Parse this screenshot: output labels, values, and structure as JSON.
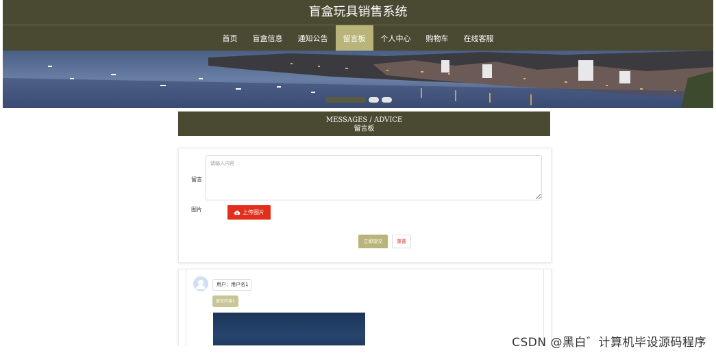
{
  "site": {
    "title": "盲盒玩具销售系统"
  },
  "nav": {
    "items": [
      {
        "label": "首页"
      },
      {
        "label": "盲盒信息"
      },
      {
        "label": "通知公告"
      },
      {
        "label": "留言板",
        "active": true
      },
      {
        "label": "个人中心"
      },
      {
        "label": "购物车"
      },
      {
        "label": "在线客服"
      }
    ]
  },
  "banner": {
    "slides": 3,
    "active_slide": 1
  },
  "section": {
    "title_en": "MESSAGES / ADVICE",
    "title_zh": "留言板"
  },
  "form": {
    "message_label": "留言",
    "message_placeholder": "请输入内容",
    "image_label": "图片",
    "upload_label": "上传图片",
    "submit_label": "立即提交",
    "reset_label": "重置"
  },
  "messages": [
    {
      "user": "用户：用户名1",
      "content": "留言内容1"
    }
  ],
  "watermark": "CSDN @黑白゛计算机毕设源码程序",
  "colors": {
    "primary": "#4a4a33",
    "accent": "#b9b57a",
    "upload": "#e22e1c"
  }
}
